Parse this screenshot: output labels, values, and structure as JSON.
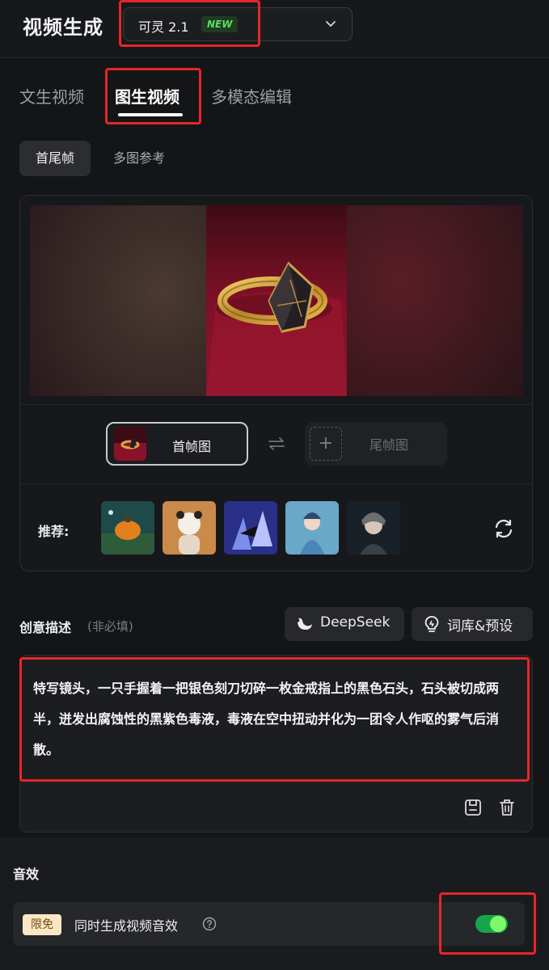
{
  "header": {
    "title": "视频生成",
    "model": {
      "name": "可灵 2.1",
      "badge": "NEW"
    }
  },
  "tabs": [
    {
      "label": "文生视频",
      "active": false
    },
    {
      "label": "图生视频",
      "active": true
    },
    {
      "label": "多模态编辑",
      "active": false
    }
  ],
  "sub_tabs": [
    {
      "label": "首尾帧",
      "active": true
    },
    {
      "label": "多图参考",
      "active": false
    }
  ],
  "frames": {
    "first_label": "首帧图",
    "last_label": "尾帧图",
    "plus": "+"
  },
  "recommend": {
    "label": "推荐:"
  },
  "prompt": {
    "label": "创意描述",
    "hint": "(非必填)",
    "deepseek_label": "DeepSeek",
    "lexicon_label": "词库&预设",
    "text": "特写镜头，一只手握着一把银色刻刀切碎一枚金戒指上的黑色石头，石头被切成两半，迸发出腐蚀性的黑紫色毒液，毒液在空中扭动并化为一团令人作呕的雾气后消散。"
  },
  "audio": {
    "title": "音效",
    "badge": "限免",
    "label": "同时生成视频音效",
    "enabled": true
  },
  "colors": {
    "background": "#141517",
    "accent_green": "#16a64a",
    "badge_green": "#5fdc62",
    "annotation_red": "#e8252a"
  }
}
